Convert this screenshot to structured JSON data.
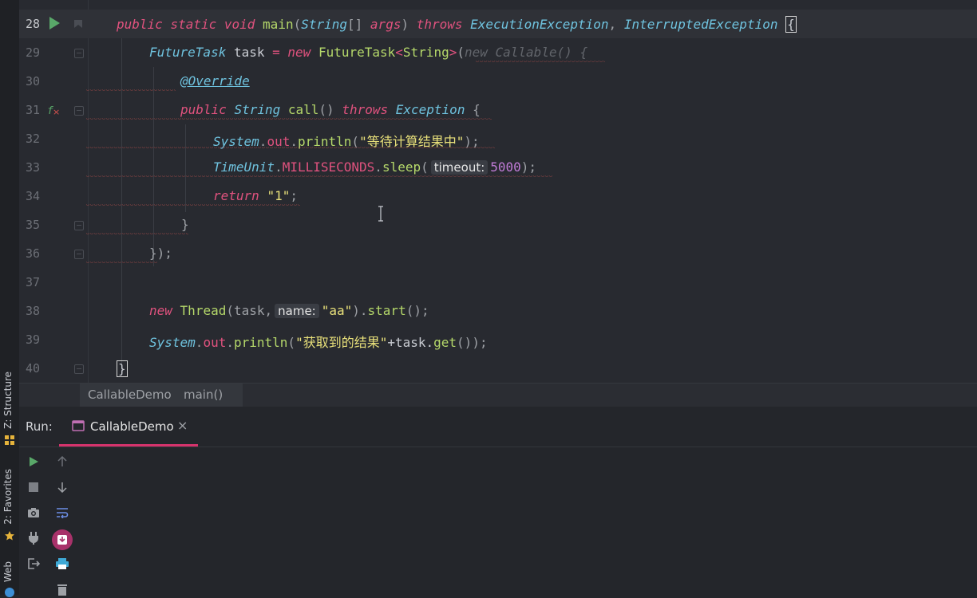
{
  "editor": {
    "lines": [
      {
        "n": "28"
      },
      {
        "n": "29"
      },
      {
        "n": "30"
      },
      {
        "n": "31"
      },
      {
        "n": "32"
      },
      {
        "n": "33"
      },
      {
        "n": "34"
      },
      {
        "n": "35"
      },
      {
        "n": "36"
      },
      {
        "n": "37"
      },
      {
        "n": "38"
      },
      {
        "n": "39"
      },
      {
        "n": "40"
      }
    ],
    "code": {
      "l28_kw1": "public",
      "l28_kw2": "static",
      "l28_kw3": "void",
      "l28_fn": "main",
      "l28_p1": "(",
      "l28_ty1": "String",
      "l28_p2": "[] ",
      "l28_arg": "args",
      "l28_p3": ") ",
      "l28_kw4": "throws",
      "l28_ty2": "ExecutionException",
      "l28_p4": ", ",
      "l28_ty3": "InterruptedException",
      "l28_brace": "{",
      "l29_ty1": "FutureTask",
      "l29_var": " task ",
      "l29_op": "= ",
      "l29_kw": "new",
      "l29_ty2": "FutureTask",
      "l29_gen1": "<",
      "l29_ty3": "String",
      "l29_gen2": ">",
      "l29_p1": "(",
      "l29_dim": "new Callable() {",
      "l30_ann": "@Override",
      "l31_kw1": "public",
      "l31_ty": "String",
      "l31_fn": "call",
      "l31_p": "() ",
      "l31_kw2": "throws",
      "l31_ty2": "Exception",
      "l31_brace": "{",
      "l32_ty": "System",
      "l32_dot1": ".",
      "l32_fld": "out",
      "l32_dot2": ".",
      "l32_fn": "println",
      "l32_p1": "(",
      "l32_str": "\"等待计算结果中\"",
      "l32_p2": ");",
      "l33_ty": "TimeUnit",
      "l33_dot1": ".",
      "l33_fld": "MILLISECONDS",
      "l33_dot2": ".",
      "l33_fn": "sleep",
      "l33_p1": "(",
      "l33_hint": "timeout:",
      "l33_num": "5000",
      "l33_p2": ");",
      "l34_kw": "return",
      "l34_str": "\"1\"",
      "l34_p": ";",
      "l35_brace": "}",
      "l36_close": "});",
      "l38_kw": "new",
      "l38_ty": "Thread",
      "l38_p1": "(task,",
      "l38_hint": "name:",
      "l38_str": "\"aa\"",
      "l38_p2": ").",
      "l38_fn": "start",
      "l38_p3": "();",
      "l39_ty": "System",
      "l39_dot1": ".",
      "l39_fld": "out",
      "l39_dot2": ".",
      "l39_fn": "println",
      "l39_p1": "(",
      "l39_str": "\"获取到的结果\"",
      "l39_op": "+task.",
      "l39_fn2": "get",
      "l39_p2": "());",
      "l40_brace": "}"
    }
  },
  "breadcrumb": {
    "items": [
      "CallableDemo",
      "main()"
    ]
  },
  "run": {
    "label": "Run:",
    "tab_label": "CallableDemo",
    "tab_close": "×"
  },
  "side_tabs": {
    "structure": "Z: Structure",
    "favorites": "2: Favorites",
    "web": "Web"
  },
  "icons": {
    "run_gutter": "play-icon",
    "lambda_gutter": "override-method-icon",
    "rerun": "play-icon",
    "stop": "stop-icon",
    "up": "arrow-up-icon",
    "down": "arrow-down-icon",
    "snapshot": "camera-icon",
    "soft_wrap": "soft-wrap-icon",
    "plug": "plug-icon",
    "import": "import-icon",
    "exit": "exit-icon",
    "print": "print-icon",
    "trash": "trash-icon"
  },
  "colors": {
    "accent_tab": "#d6336c",
    "keyword": "#e0527e",
    "type": "#6fc3df",
    "function": "#b5d86a",
    "string": "#e8e07a",
    "number": "#c07bd6",
    "run_green": "#59a869"
  }
}
